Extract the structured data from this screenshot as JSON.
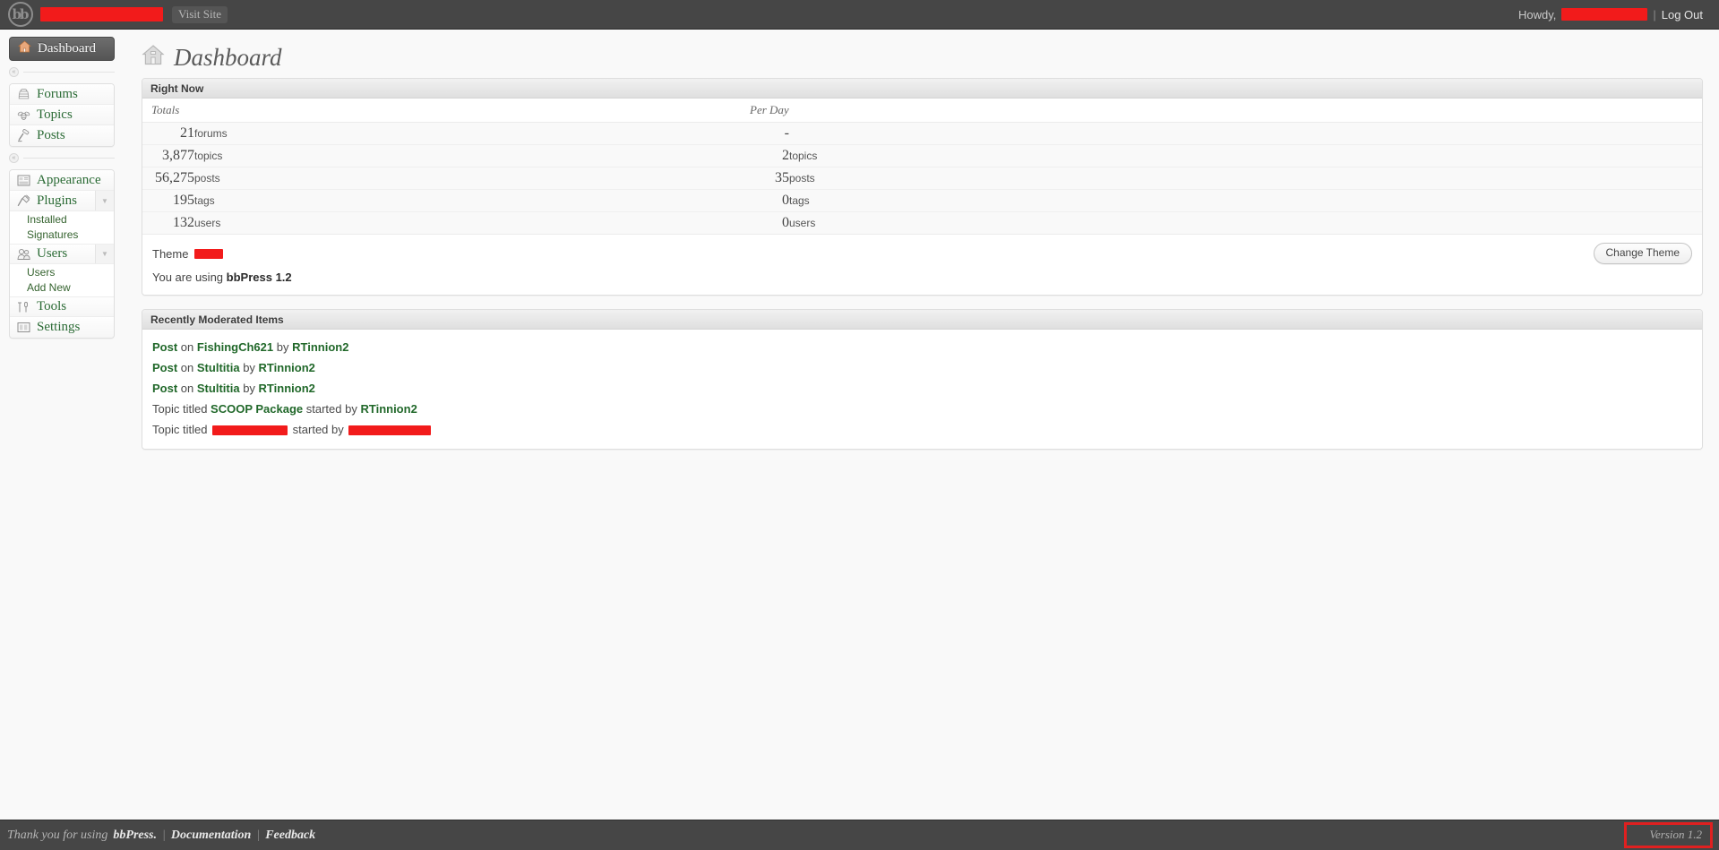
{
  "adminbar": {
    "logo_text": "bb",
    "logo_icon": "bbpress-logo-icon",
    "site_name_redacted": true,
    "visit_site_label": "Visit Site",
    "howdy_label": "Howdy,",
    "username_redacted": true,
    "separator": "|",
    "logout_label": "Log Out"
  },
  "sidebar": {
    "dashboard": {
      "label": "Dashboard",
      "icon": "home-icon",
      "active": true
    },
    "groups": [
      {
        "items": [
          {
            "label": "Forums",
            "icon": "forums-icon"
          },
          {
            "label": "Topics",
            "icon": "topics-icon"
          },
          {
            "label": "Posts",
            "icon": "posts-icon"
          }
        ]
      },
      {
        "items": [
          {
            "label": "Appearance",
            "icon": "appearance-icon"
          },
          {
            "label": "Plugins",
            "icon": "plugins-icon",
            "arrow": "▼",
            "submenu": [
              {
                "label": "Installed"
              },
              {
                "label": "Signatures"
              }
            ]
          },
          {
            "label": "Users",
            "icon": "users-icon",
            "arrow": "▼",
            "submenu": [
              {
                "label": "Users"
              },
              {
                "label": "Add New"
              }
            ]
          },
          {
            "label": "Tools",
            "icon": "tools-icon"
          },
          {
            "label": "Settings",
            "icon": "settings-icon"
          }
        ]
      }
    ],
    "collapse_glyph": "«"
  },
  "page": {
    "title": "Dashboard",
    "title_icon": "home-icon"
  },
  "right_now": {
    "panel_title": "Right Now",
    "columns": {
      "totals": "Totals",
      "per_day": "Per Day"
    },
    "rows": [
      {
        "total_value": "21",
        "total_label": "forums",
        "per_day_value": "-",
        "per_day_label": ""
      },
      {
        "total_value": "3,877",
        "total_label": "topics",
        "per_day_value": "2",
        "per_day_label": "topics"
      },
      {
        "total_value": "56,275",
        "total_label": "posts",
        "per_day_value": "35",
        "per_day_label": "posts"
      },
      {
        "total_value": "195",
        "total_label": "tags",
        "per_day_value": "0",
        "per_day_label": "tags"
      },
      {
        "total_value": "132",
        "total_label": "users",
        "per_day_value": "0",
        "per_day_label": "users"
      }
    ],
    "theme_label": "Theme",
    "theme_name_redacted": true,
    "change_theme_label": "Change Theme",
    "using_prefix": "You are using",
    "using_version": "bbPress 1.2"
  },
  "recently_moderated": {
    "panel_title": "Recently Moderated Items",
    "items": [
      {
        "type": "post",
        "kind_label": "Post",
        "mid_label": "on",
        "target": "FishingCh621",
        "by_label": "by",
        "author": "RTinnion2",
        "redacted_target": false,
        "redacted_author": false
      },
      {
        "type": "post",
        "kind_label": "Post",
        "mid_label": "on",
        "target": "Stultitia",
        "by_label": "by",
        "author": "RTinnion2",
        "redacted_target": false,
        "redacted_author": false
      },
      {
        "type": "post",
        "kind_label": "Post",
        "mid_label": "on",
        "target": "Stultitia",
        "by_label": "by",
        "author": "RTinnion2",
        "redacted_target": false,
        "redacted_author": false
      },
      {
        "type": "topic",
        "kind_label": "Topic titled",
        "mid_label": "",
        "target": "SCOOP Package",
        "by_label": "started by",
        "author": "RTinnion2",
        "redacted_target": false,
        "redacted_author": false
      },
      {
        "type": "topic",
        "kind_label": "Topic titled",
        "mid_label": "",
        "target": "",
        "by_label": "started by",
        "author": "",
        "redacted_target": true,
        "redacted_author": true
      }
    ]
  },
  "footer": {
    "thanks_text": "Thank you for using",
    "product": "bbPress.",
    "sep1": "|",
    "documentation_label": "Documentation",
    "sep2": "|",
    "feedback_label": "Feedback",
    "version_label": "Version 1.2"
  },
  "colors": {
    "admin_bar": "#464646",
    "link_green": "#21682a",
    "redaction": "#f21b1b",
    "highlight_box": "#e02020",
    "page_background": "#f9f9f9"
  }
}
